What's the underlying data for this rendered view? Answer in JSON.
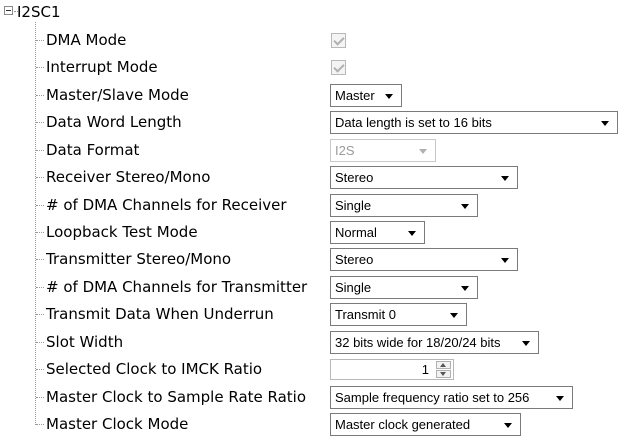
{
  "tree": {
    "root_label": "I2SC1",
    "properties": [
      {
        "label": "DMA Mode",
        "control": "checkbox",
        "checked": true,
        "enabled": false
      },
      {
        "label": "Interrupt Mode",
        "control": "checkbox",
        "checked": true,
        "enabled": false
      },
      {
        "label": "Master/Slave Mode",
        "control": "dropdown",
        "value": "Master"
      },
      {
        "label": "Data Word Length",
        "control": "dropdown",
        "value": "Data length is set to 16 bits"
      },
      {
        "label": "Data Format",
        "control": "dropdown",
        "value": "I2S",
        "enabled": false
      },
      {
        "label": "Receiver Stereo/Mono",
        "control": "dropdown",
        "value": "Stereo"
      },
      {
        "label": "# of DMA Channels for Receiver",
        "control": "dropdown",
        "value": "Single"
      },
      {
        "label": "Loopback Test Mode",
        "control": "dropdown",
        "value": "Normal"
      },
      {
        "label": "Transmitter Stereo/Mono",
        "control": "dropdown",
        "value": "Stereo"
      },
      {
        "label": "# of DMA Channels for Transmitter",
        "control": "dropdown",
        "value": "Single"
      },
      {
        "label": "Transmit Data When Underrun",
        "control": "dropdown",
        "value": "Transmit 0"
      },
      {
        "label": "Slot Width",
        "control": "dropdown",
        "value": "32 bits wide for 18/20/24 bits"
      },
      {
        "label": "Selected Clock to IMCK Ratio",
        "control": "spinner",
        "value": "1"
      },
      {
        "label": "Master Clock to Sample Rate Ratio",
        "control": "dropdown",
        "value": "Sample frequency ratio set to 256"
      },
      {
        "label": "Master Clock Mode",
        "control": "dropdown",
        "value": "Master clock generated"
      }
    ]
  }
}
